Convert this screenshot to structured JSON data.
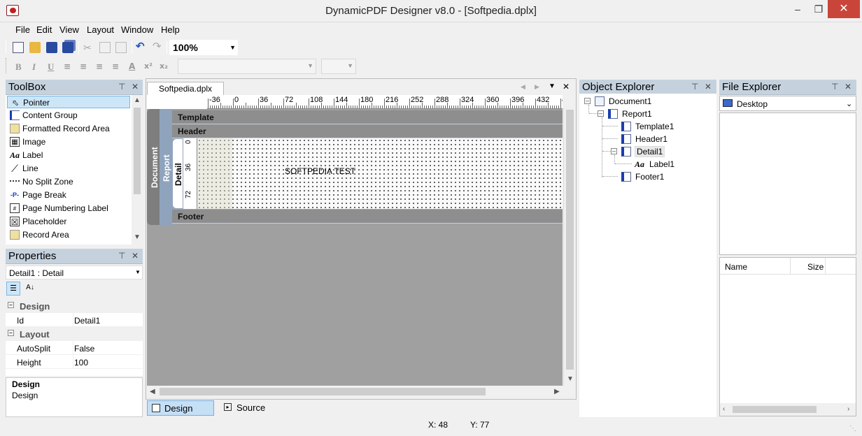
{
  "window": {
    "title": "DynamicPDF Designer v8.0 - [Softpedia.dplx]"
  },
  "menu": [
    "File",
    "Edit",
    "View",
    "Layout",
    "Window",
    "Help"
  ],
  "toolbar": {
    "zoom": "100%"
  },
  "format_toolbar": {
    "buttons": [
      "B",
      "I",
      "U"
    ]
  },
  "toolbox": {
    "title": "ToolBox",
    "items": [
      {
        "label": "Pointer",
        "icon": "pointer-icon"
      },
      {
        "label": "Content Group",
        "icon": "content-group-icon"
      },
      {
        "label": "Formatted Record Area",
        "icon": "formatted-record-area-icon"
      },
      {
        "label": "Image",
        "icon": "image-icon"
      },
      {
        "label": "Label",
        "icon": "label-icon"
      },
      {
        "label": "Line",
        "icon": "line-icon"
      },
      {
        "label": "No Split Zone",
        "icon": "no-split-zone-icon"
      },
      {
        "label": "Page Break",
        "icon": "page-break-icon"
      },
      {
        "label": "Page Numbering Label",
        "icon": "page-numbering-label-icon"
      },
      {
        "label": "Placeholder",
        "icon": "placeholder-icon"
      },
      {
        "label": "Record Area",
        "icon": "record-area-icon"
      }
    ]
  },
  "properties": {
    "title": "Properties",
    "selected": "Detail1 : Detail",
    "categories": [
      {
        "name": "Design",
        "rows": [
          {
            "key": "Id",
            "value": "Detail1"
          }
        ]
      },
      {
        "name": "Layout",
        "rows": [
          {
            "key": "AutoSplit",
            "value": "False"
          },
          {
            "key": "Height",
            "value": "100"
          }
        ]
      }
    ],
    "desc_title": "Design",
    "desc_text": "Design"
  },
  "designer": {
    "tab": "Softpedia.dplx *",
    "ruler": [
      "-36",
      "0",
      "36",
      "72",
      "108",
      "144",
      "180",
      "216",
      "252",
      "288",
      "324",
      "360",
      "396",
      "432",
      "4"
    ],
    "vruler": [
      "0",
      "36",
      "72"
    ],
    "bands": {
      "document": "Document",
      "report": "Report",
      "template": "Template",
      "header": "Header",
      "detail": "Detail",
      "footer": "Footer"
    },
    "label_text": "SOFTPEDIA TEST",
    "tabs": [
      "Design",
      "Source"
    ]
  },
  "object_explorer": {
    "title": "Object Explorer",
    "tree": [
      "Document1",
      "Report1",
      "Template1",
      "Header1",
      "Detail1",
      "Label1",
      "Footer1"
    ]
  },
  "file_explorer": {
    "title": "File Explorer",
    "location": "Desktop",
    "columns": [
      "Name",
      "Size"
    ]
  },
  "status": {
    "x": "X: 48",
    "y": "Y: 77"
  }
}
